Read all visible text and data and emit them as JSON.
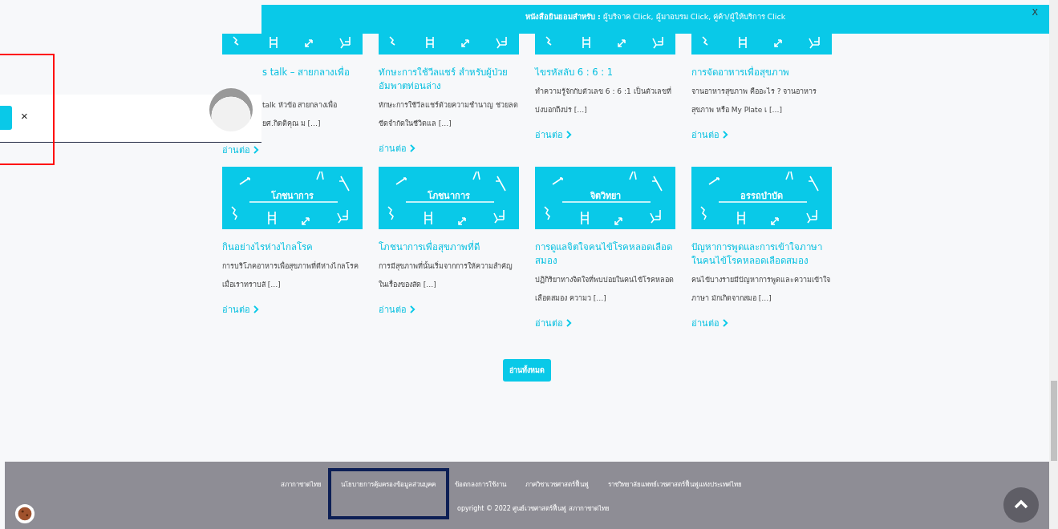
{
  "banner": {
    "text": "**หนังสือยินยอมสำหรับ :** ผู้บริจาค Click, ผู้มาอบรม Click, คู่ค้า/ผู้ให้บริการ Click",
    "close": "X"
  },
  "popup": {
    "close": "×"
  },
  "articles": [
    {
      "title": "s talk – สายกลางเพื่อ",
      "excerpt": "talk หัวข้อ สายกลางเพื่อ ยศ.กิตติคุณ ม […]",
      "more": "อ่านต่อ"
    },
    {
      "title": "ทักษะการใช้วีลแชร์ สำหรับผู้ป่วยอัมพาตท่อนล่าง",
      "excerpt": "ทักษะการใช้วีลแชร์ด้วยความชำนาญ ช่วยลดขีดจำกัดในชีวิตแล […]",
      "more": "อ่านต่อ"
    },
    {
      "title": "ไขรหัสลับ 6 : 6 : 1",
      "excerpt": "ทำความรู้จักกับตัวเลข 6 : 6 :1 เป็นตัวเลขที่บ่งบอกถึงปร […]",
      "more": "อ่านต่อ"
    },
    {
      "title": "การจัดอาหารเพื่อสุขภาพ",
      "excerpt": "จานอาหารสุขภาพ คืออะไร ? จานอาหารสุขภาพ หรือ My Plate เ […]",
      "more": "อ่านต่อ"
    },
    {
      "image_label": "โภชนาการ",
      "title": "กินอย่างไรห่างไกลโรค",
      "excerpt": "การบริโภคอาหารเพื่อสุขภาพที่ดีห่างไกลโรค เมื่อเราทราบสั […]",
      "more": "อ่านต่อ"
    },
    {
      "image_label": "โภชนาการ",
      "title": "โภชนาการเพื่อสุขภาพที่ดี",
      "excerpt": "การมีสุขภาพที่นั้นเริ่มจากการให้ความสำคัญในเรื่องของสัด […]",
      "more": "อ่านต่อ"
    },
    {
      "image_label": "จิตวิทยา",
      "title": "การดูแลจิตใจคนไข้โรคหลอดเลือดสมอง",
      "excerpt": "ปฏิกิริยาทางจิตใจที่พบบ่อยในคนไข้โรคหลอดเลือดสมอง ความว […]",
      "more": "อ่านต่อ"
    },
    {
      "image_label": "อรรถบำบัด",
      "title": "ปัญหาการพูดและการเข้าใจภาษาในคนไข้โรคหลอดเลือดสมอง",
      "excerpt": "คนไข้บางรายมีปัญหาการพูดและความเข้าใจภาษา มักเกิดจากสมอ […]",
      "more": "อ่านต่อ"
    }
  ],
  "read_all": "อ่านทั้งหมด",
  "footer": {
    "links": [
      "สภากาชาดไทย",
      "นโยบายการคุ้มครองข้อมูลส่วนบุคค",
      "ข้อตกลงการใช้งาน",
      "ภาควิชาเวชศาสตร์ฟื้นฟู",
      "ราชวิทยาลัยแพทย์เวชศาสตร์ฟื้นฟูแห่งประเทศไทย"
    ],
    "copyright": "opyright © 2022 ศูนย์เวชศาสตร์ฟื้นฟู สภากาชาดไทย"
  }
}
